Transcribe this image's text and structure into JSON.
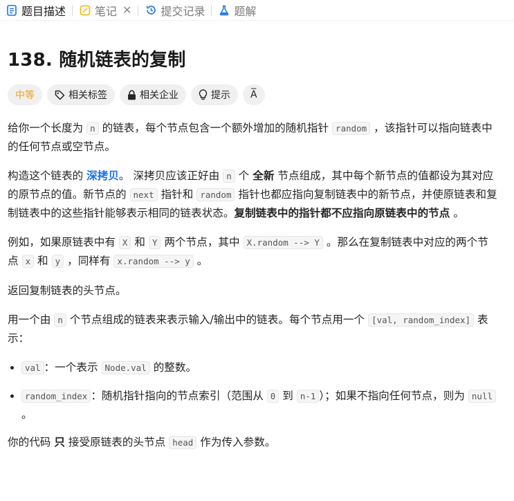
{
  "tabs": [
    {
      "label": "题目描述"
    },
    {
      "label": "笔记"
    },
    {
      "label": "提交记录"
    },
    {
      "label": "题解"
    }
  ],
  "close_symbol": "✕",
  "title": "138. 随机链表的复制",
  "tags": {
    "difficulty": "中等",
    "related_tags": "相关标签",
    "related_companies": "相关企业",
    "hint": "提示",
    "translate": "A̅"
  },
  "colors": {
    "difficulty": "#f0a020",
    "link": "#1a73e8"
  },
  "p1": {
    "t1": "给你一个长度为 ",
    "c1": "n",
    "t2": " 的链表，每个节点包含一个额外增加的随机指针 ",
    "c2": "random",
    "t3": " ，该指针可以指向链表中的任何节点或空节点。"
  },
  "p2": {
    "t1": "构造这个链表的 ",
    "link": "深拷贝",
    "t2": "。 深拷贝应该正好由 ",
    "c1": "n",
    "t3": " 个 ",
    "b1": "全新",
    "t4": " 节点组成，其中每个新节点的值都设为其对应的原节点的值。新节点的 ",
    "c2": "next",
    "t5": " 指针和 ",
    "c3": "random",
    "t6": " 指针也都应指向复制链表中的新节点，并使原链表和复制链表中的这些指针能够表示相同的链表状态。",
    "b2": "复制链表中的指针都不应指向原链表中的节点",
    "t7": " 。"
  },
  "p3": {
    "t1": "例如，如果原链表中有 ",
    "c1": "X",
    "t2": " 和 ",
    "c2": "Y",
    "t3": " 两个节点，其中 ",
    "c3": "X.random --> Y",
    "t4": " 。那么在复制链表中对应的两个节点 ",
    "c4": "x",
    "t5": " 和 ",
    "c5": "y",
    "t6": " ，同样有 ",
    "c6": "x.random --> y",
    "t7": " 。"
  },
  "p4": {
    "t1": "返回复制链表的头节点。"
  },
  "p5": {
    "t1": "用一个由 ",
    "c1": "n",
    "t2": " 个节点组成的链表来表示输入/输出中的链表。每个节点用一个 ",
    "c2": "[val, random_index]",
    "t3": " 表示："
  },
  "list": [
    {
      "c1": "val",
      "t1": "：一个表示 ",
      "c2": "Node.val",
      "t2": " 的整数。"
    },
    {
      "c1": "random_index",
      "t1": "：随机指针指向的节点索引（范围从 ",
      "c2": "0",
      "t2": " 到 ",
      "c3": "n-1",
      "t3": "）；如果不指向任何节点，则为 ",
      "c4": "null",
      "t4": " 。"
    }
  ],
  "p6": {
    "t1": "你的代码 ",
    "b1": "只",
    "t2": " 接受原链表的头节点 ",
    "c1": "head",
    "t3": " 作为传入参数。"
  }
}
